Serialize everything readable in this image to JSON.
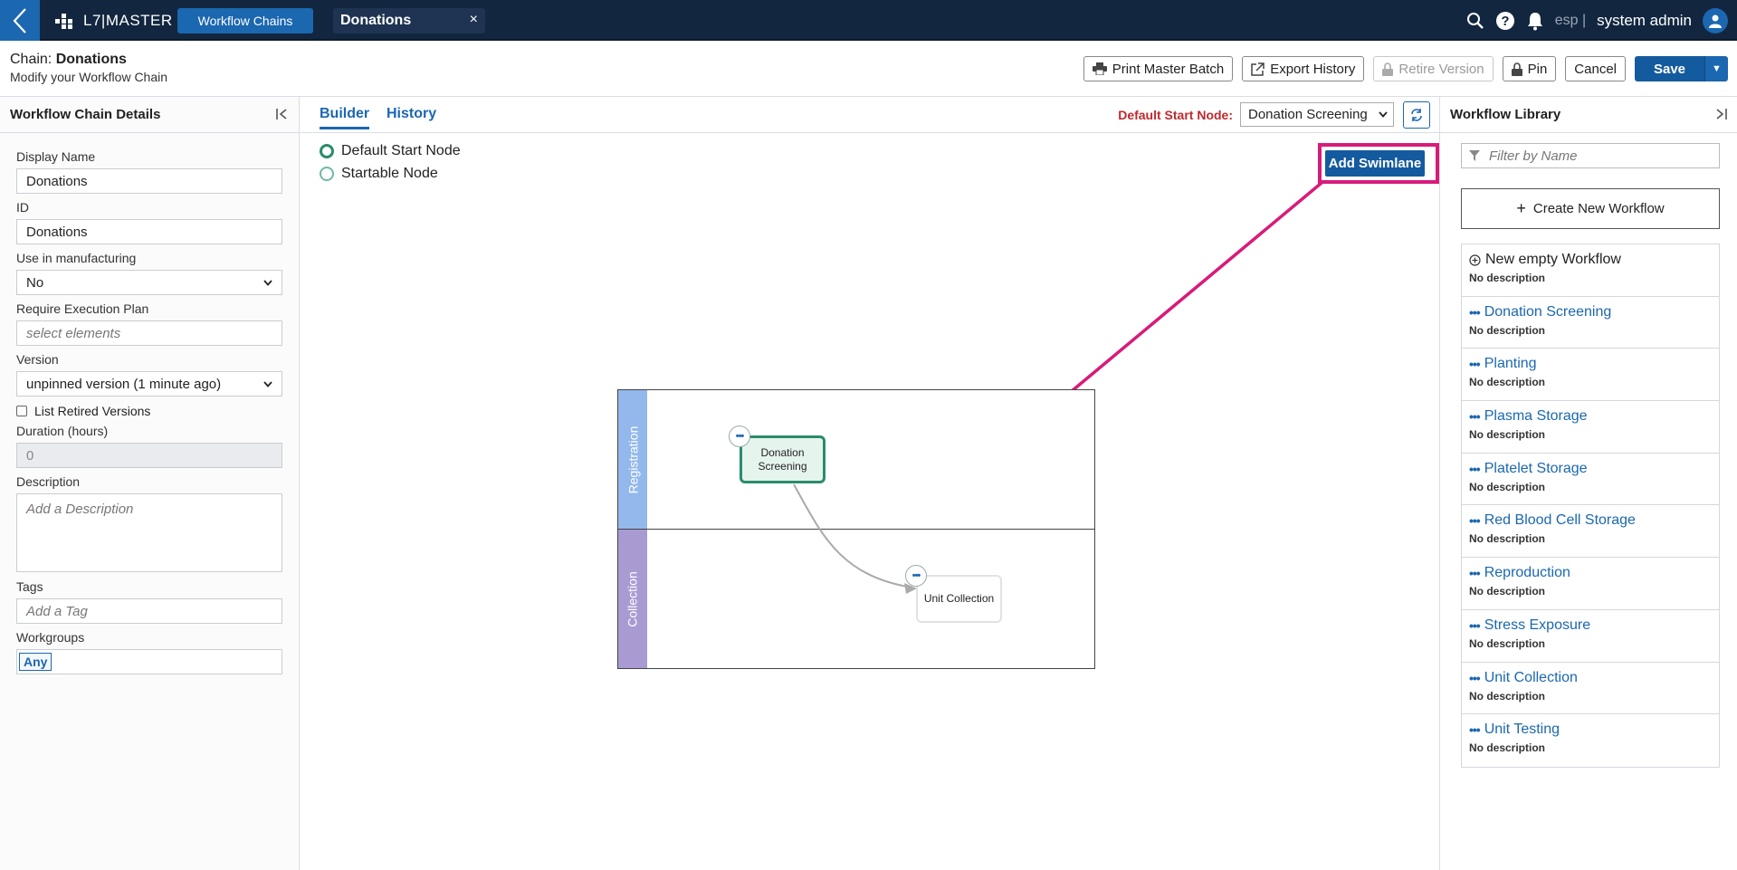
{
  "topbar": {
    "brand": "L7|MASTER",
    "active_tab": "Workflow Chains",
    "doc_tab": "Donations",
    "doc_tab_close": "×",
    "lang": "esp |",
    "user": "system admin"
  },
  "header": {
    "chain_prefix": "Chain:",
    "chain_name": "Donations",
    "subtitle": "Modify your Workflow Chain",
    "actions": {
      "print": "Print Master Batch",
      "export": "Export History",
      "retire": "Retire Version",
      "pin": "Pin",
      "cancel": "Cancel",
      "save": "Save"
    }
  },
  "left_panel": {
    "title": "Workflow Chain Details",
    "fields": {
      "display_name_label": "Display Name",
      "display_name_value": "Donations",
      "id_label": "ID",
      "id_value": "Donations",
      "manufacturing_label": "Use in manufacturing",
      "manufacturing_value": "No",
      "execution_plan_label": "Require Execution Plan",
      "execution_plan_placeholder": "select elements",
      "version_label": "Version",
      "version_value": "unpinned version (1 minute ago)",
      "retired_label": "List Retired Versions",
      "duration_label": "Duration (hours)",
      "duration_value": "0",
      "description_label": "Description",
      "description_placeholder": "Add a Description",
      "tags_label": "Tags",
      "tags_placeholder": "Add a Tag",
      "workgroups_label": "Workgroups",
      "workgroups_chip": "Any"
    }
  },
  "center": {
    "tabs": {
      "builder": "Builder",
      "history": "History"
    },
    "start_node_label": "Default Start Node:",
    "start_node_value": "Donation Screening",
    "legend": {
      "default_start": "Default Start Node",
      "startable": "Startable Node"
    },
    "add_swimlane": "Add Swimlane",
    "annotation_color": "#d81b7a",
    "swimlanes": [
      {
        "label": "Registration",
        "color": "#93b8ec"
      },
      {
        "label": "Collection",
        "color": "#a99bd2"
      }
    ],
    "nodes": {
      "start_node": "Donation Screening",
      "second_node": "Unit Collection",
      "menu_glyph": "•••"
    }
  },
  "right_panel": {
    "title": "Workflow Library",
    "filter_placeholder": "Filter by Name",
    "create_button": "Create New Workflow",
    "items": [
      {
        "title": "New empty Workflow",
        "desc": "No description"
      },
      {
        "title": "Donation Screening",
        "desc": "No description"
      },
      {
        "title": "Planting",
        "desc": "No description"
      },
      {
        "title": "Plasma Storage",
        "desc": "No description"
      },
      {
        "title": "Platelet Storage",
        "desc": "No description"
      },
      {
        "title": "Red Blood Cell Storage",
        "desc": "No description"
      },
      {
        "title": "Reproduction",
        "desc": "No description"
      },
      {
        "title": "Stress Exposure",
        "desc": "No description"
      },
      {
        "title": "Unit Collection",
        "desc": "No description"
      },
      {
        "title": "Unit Testing",
        "desc": "No description"
      }
    ]
  },
  "colors": {
    "topbar_bg": "#12263f",
    "primary": "#1b67b0",
    "start_node": "#2a8c6a",
    "required_label": "#c0282e"
  }
}
